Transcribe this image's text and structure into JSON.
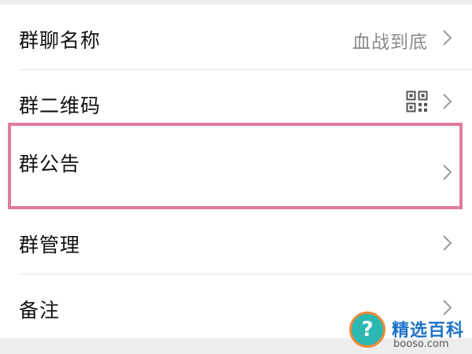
{
  "settings": {
    "rows": [
      {
        "label": "群聊名称",
        "value": "血战到底"
      },
      {
        "label": "群二维码"
      },
      {
        "label": "群公告"
      },
      {
        "label": "群管理"
      },
      {
        "label": "备注"
      }
    ]
  },
  "icons": {
    "chevron": "chevron-right-icon",
    "qr": "qr-code-icon"
  },
  "colors": {
    "highlight": "#e07aa0",
    "background": "#ededed",
    "row": "#ffffff",
    "value_text": "#8a8a8a"
  },
  "watermark": {
    "symbol": "?",
    "title": "精选百科",
    "url": "booso.com"
  }
}
